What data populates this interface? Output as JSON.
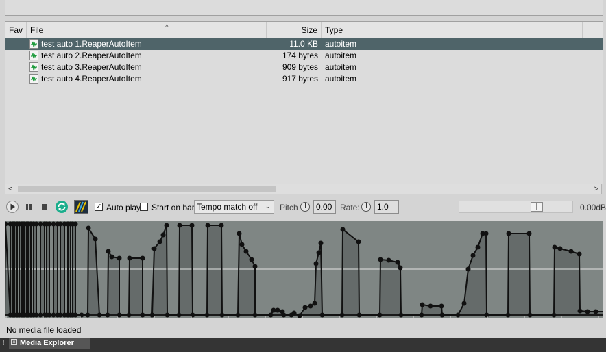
{
  "columns": {
    "fav": "Fav",
    "file": "File",
    "size": "Size",
    "type": "Type"
  },
  "files": [
    {
      "name": "test auto 1.ReaperAutoItem",
      "size": "11.0 KB",
      "type": "autoitem",
      "selected": true
    },
    {
      "name": "test auto 2.ReaperAutoItem",
      "size": "174 bytes",
      "type": "autoitem",
      "selected": false
    },
    {
      "name": "test auto 3.ReaperAutoItem",
      "size": "909 bytes",
      "type": "autoitem",
      "selected": false
    },
    {
      "name": "test auto 4.ReaperAutoItem",
      "size": "917 bytes",
      "type": "autoitem",
      "selected": false
    }
  ],
  "transport": {
    "autoplay_label": "Auto play",
    "autoplay_checked": true,
    "startonbar_label": "Start on bar",
    "startonbar_checked": false,
    "tempo_value": "Tempo match off",
    "pitch_label": "Pitch",
    "pitch_value": "0.00",
    "rate_label": "Rate:",
    "rate_value": "1.0",
    "volume_label": "0.00dB"
  },
  "status": "No media file loaded",
  "tab": {
    "label": "Media Explorer",
    "alert": "!"
  },
  "colors": {
    "selection": "#4f6469",
    "wave_bg": "#7f8684",
    "wave_fill": "#656b6a",
    "accent": "#1aae8c"
  }
}
